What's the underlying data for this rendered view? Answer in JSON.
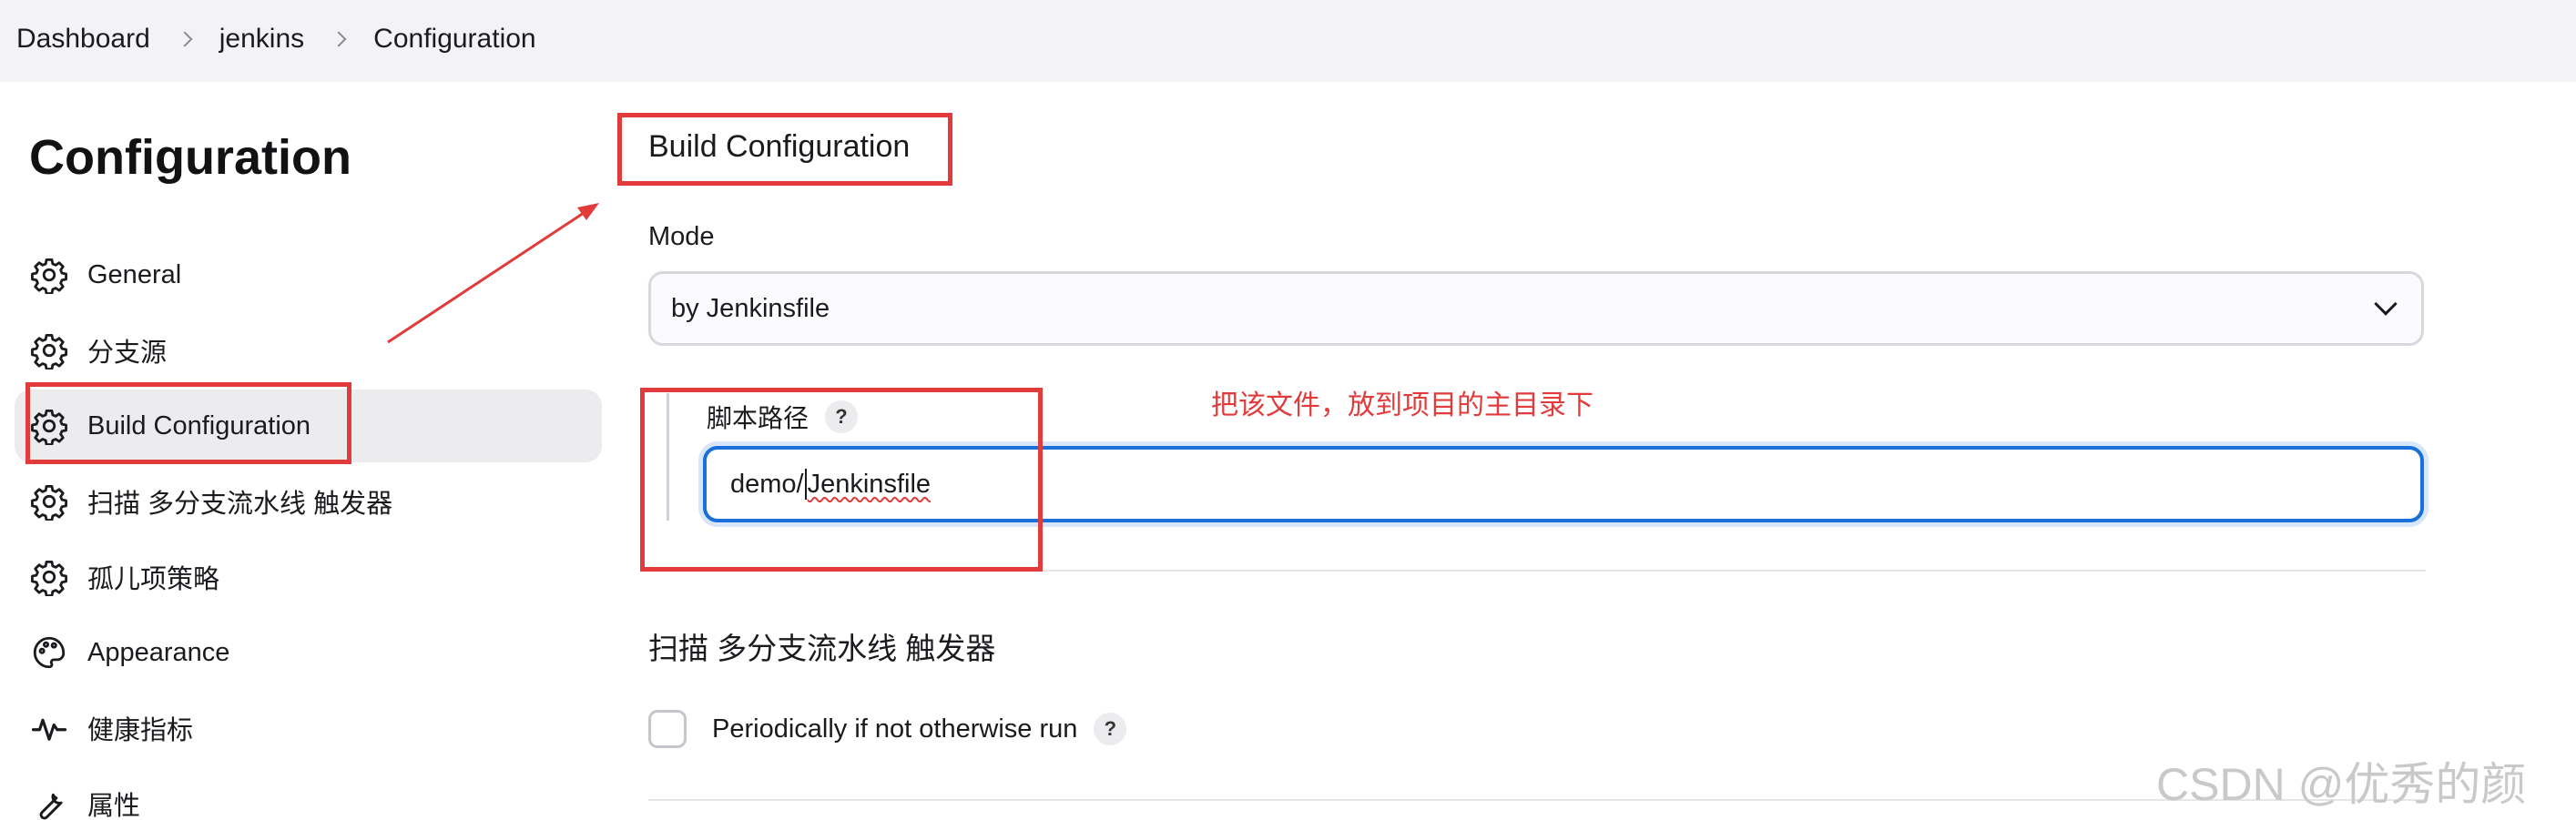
{
  "breadcrumb": [
    "Dashboard",
    "jenkins",
    "Configuration"
  ],
  "page_title": "Configuration",
  "sidebar": {
    "items": [
      {
        "label": "General",
        "icon": "gear-icon"
      },
      {
        "label": "分支源",
        "icon": "gear-icon"
      },
      {
        "label": "Build Configuration",
        "icon": "gear-icon",
        "active": true
      },
      {
        "label": "扫描 多分支流水线 触发器",
        "icon": "gear-icon"
      },
      {
        "label": "孤儿项策略",
        "icon": "gear-icon"
      },
      {
        "label": "Appearance",
        "icon": "palette-icon"
      },
      {
        "label": "健康指标",
        "icon": "pulse-icon"
      },
      {
        "label": "属性",
        "icon": "wrench-icon"
      }
    ]
  },
  "main": {
    "section_title": "Build Configuration",
    "mode_label": "Mode",
    "mode_value": "by Jenkinsfile",
    "script_path_label": "脚本路径",
    "help": "?",
    "script_path_value_prefix": "demo/",
    "script_path_value_word": "Jenkinsfile",
    "scan_section_title": "扫描 多分支流水线 触发器",
    "periodic_label": "Periodically if not otherwise run"
  },
  "annotation": {
    "note": "把该文件，放到项目的主目录下",
    "color": "#e23b3b"
  },
  "watermark": "CSDN @优秀的颜",
  "colors": {
    "accent": "#1a6fd8",
    "topbar": "#f3f3f5",
    "active_item": "#ececef"
  }
}
